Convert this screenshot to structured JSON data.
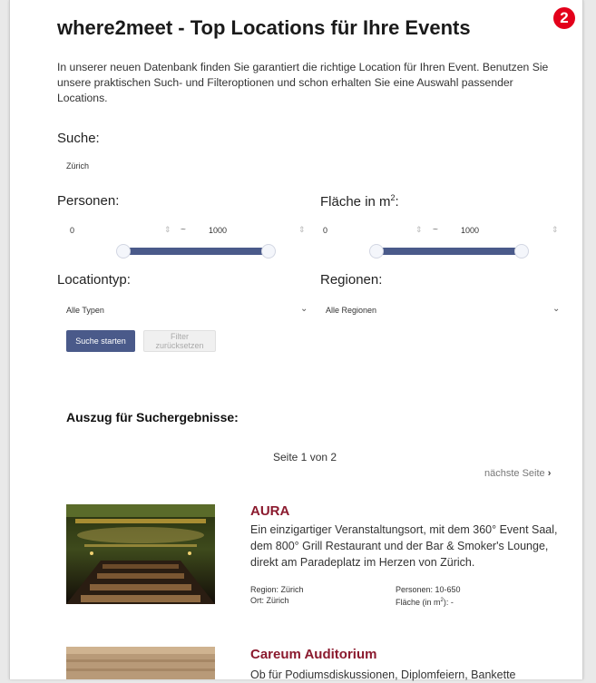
{
  "badge": "2",
  "page": {
    "title": "where2meet - Top Locations für Ihre Events",
    "intro": "In unserer neuen Datenbank finden Sie garantiert die richtige Location für Ihren Event. Benutzen Sie unsere praktischen Such- und Filteroptionen und schon erhalten Sie eine Auswahl passender Locations."
  },
  "search": {
    "label": "Suche:",
    "value": "Zürich"
  },
  "persons": {
    "label": "Personen:",
    "min": "0",
    "max": "1000",
    "range_from_fraction": 0.0,
    "range_to_fraction": 1.0
  },
  "area": {
    "label": "Fläche in m",
    "label_sup": "2",
    "label_colon": ":",
    "min": "0",
    "max": "1000",
    "range_from_fraction": 0.0,
    "range_to_fraction": 1.0
  },
  "range_separator": "~",
  "location_type": {
    "label": "Locationtyp:",
    "selected": "Alle Typen"
  },
  "regions": {
    "label": "Regionen:",
    "selected": "Alle Regionen"
  },
  "buttons": {
    "search": "Suche starten",
    "reset": "Filter zurücksetzen"
  },
  "results": {
    "title": "Auszug für Suchergebnisse:",
    "page_info": "Seite 1 von 2",
    "next_page": "nächste Seite"
  },
  "locations": [
    {
      "name": "AURA",
      "description": "Ein einzigartiger Veranstaltungsort, mit dem 360° Event Saal, dem 800° Grill Restaurant und der Bar & Smoker's Lounge, direkt am Paradeplatz im Herzen von Zürich.",
      "region": "Region: Zürich",
      "ort": "Ort: Zürich",
      "personen": "Personen: 10-650",
      "flaeche_prefix": "Fläche (in m",
      "flaeche_sup": "2",
      "flaeche_suffix": "): -"
    },
    {
      "name": "Careum Auditorium",
      "description": "Ob für Podiumsdiskussionen, Diplomfeiern, Bankette"
    }
  ],
  "colors": {
    "accent": "#4a5a8a",
    "location_name": "#8b1a2e",
    "badge": "#e3001b"
  }
}
